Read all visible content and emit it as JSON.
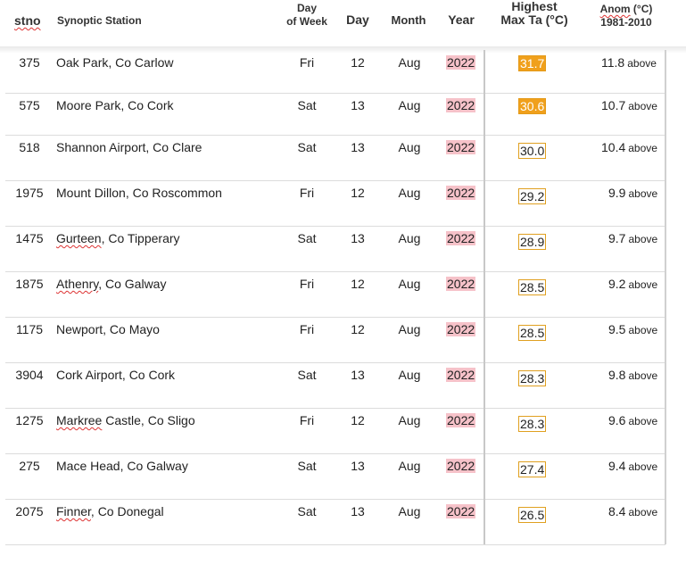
{
  "header": {
    "stno": "stno",
    "station": "Synoptic Station",
    "dow_line1": "Day",
    "dow_line2": "of Week",
    "day": "Day",
    "month": "Month",
    "year": "Year",
    "max_line1": "Highest",
    "max_line2": "Max Ta (°C)",
    "anom_line1_word": "Anom",
    "anom_line1_unit": " (°C)",
    "anom_line2": "1981-2010"
  },
  "rows": [
    {
      "stno": "375",
      "station": "Oak Park, Co Carlow",
      "dow": "Fri",
      "day": "12",
      "month": "Aug",
      "year": "2022",
      "max": "31.7",
      "anom": "11.8",
      "above": "above"
    },
    {
      "stno": "575",
      "station": "Moore Park, Co Cork",
      "dow": "Sat",
      "day": "13",
      "month": "Aug",
      "year": "2022",
      "max": "30.6",
      "anom": "10.7",
      "above": "above"
    },
    {
      "stno": "518",
      "station": "Shannon Airport, Co Clare",
      "dow": "Sat",
      "day": "13",
      "month": "Aug",
      "year": "2022",
      "max": "30.0",
      "anom": "10.4",
      "above": "above"
    },
    {
      "stno": "1975",
      "station": "Mount Dillon, Co Roscommon",
      "dow": "Fri",
      "day": "12",
      "month": "Aug",
      "year": "2022",
      "max": "29.2",
      "anom": "9.9",
      "above": "above"
    },
    {
      "stno": "1475",
      "station_word": "Gurteen",
      "station_rest": ", Co Tipperary",
      "dow": "Sat",
      "day": "13",
      "month": "Aug",
      "year": "2022",
      "max": "28.9",
      "anom": "9.7",
      "above": "above"
    },
    {
      "stno": "1875",
      "station_word": "Athenry",
      "station_rest": ", Co Galway",
      "dow": "Fri",
      "day": "12",
      "month": "Aug",
      "year": "2022",
      "max": "28.5",
      "anom": "9.2",
      "above": "above"
    },
    {
      "stno": "1175",
      "station": "Newport, Co Mayo",
      "dow": "Fri",
      "day": "12",
      "month": "Aug",
      "year": "2022",
      "max": "28.5",
      "anom": "9.5",
      "above": "above"
    },
    {
      "stno": "3904",
      "station": "Cork Airport, Co Cork",
      "dow": "Sat",
      "day": "13",
      "month": "Aug",
      "year": "2022",
      "max": "28.3",
      "anom": "9.8",
      "above": "above"
    },
    {
      "stno": "1275",
      "station_word": "Markree",
      "station_rest": " Castle, Co Sligo",
      "dow": "Fri",
      "day": "12",
      "month": "Aug",
      "year": "2022",
      "max": "28.3",
      "anom": "9.6",
      "above": "above"
    },
    {
      "stno": "275",
      "station": "Mace Head, Co Galway",
      "dow": "Sat",
      "day": "13",
      "month": "Aug",
      "year": "2022",
      "max": "27.4",
      "anom": "9.4",
      "above": "above"
    },
    {
      "stno": "2075",
      "station_word": "Finner",
      "station_rest": ", Co Donegal",
      "dow": "Sat",
      "day": "13",
      "month": "Aug",
      "year": "2022",
      "max": "26.5",
      "anom": "8.4",
      "above": "above"
    }
  ],
  "colors": {
    "year_highlight": "#f6c2c9",
    "hot_fill": "#f0a01c",
    "box_border": "#e0a020"
  }
}
